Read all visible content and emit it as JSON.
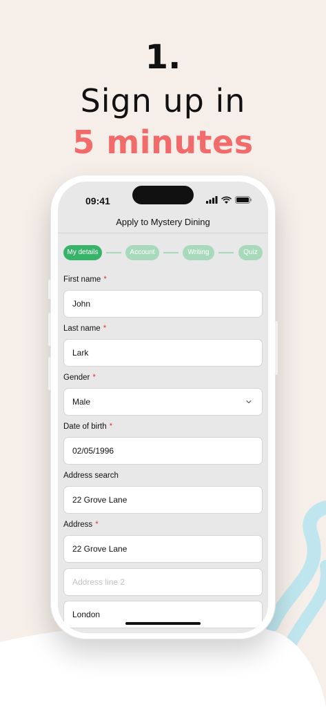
{
  "headline": {
    "step_number": "1.",
    "line1": "Sign up in",
    "line2": "5 minutes"
  },
  "colors": {
    "background": "#f5eee9",
    "accent_red": "#f26b6b",
    "wave_teal": "#bfe6ee",
    "step_active": "#37b36a",
    "step_inactive": "#a9d9bb",
    "required_star": "#e03a3a"
  },
  "status_bar": {
    "time": "09:41",
    "icons": [
      "cellular-signal-icon",
      "wifi-icon",
      "battery-icon"
    ]
  },
  "app": {
    "title": "Apply to Mystery Dining"
  },
  "stepper": {
    "steps": [
      {
        "label": "My details",
        "active": true
      },
      {
        "label": "Account",
        "active": false
      },
      {
        "label": "Writing",
        "active": false
      },
      {
        "label": "Quiz",
        "active": false
      }
    ]
  },
  "form": {
    "required_marker": "*",
    "first_name": {
      "label": "First name",
      "value": "John"
    },
    "last_name": {
      "label": "Last name",
      "value": "Lark"
    },
    "gender": {
      "label": "Gender",
      "value": "Male"
    },
    "dob": {
      "label": "Date of birth",
      "value": "02/05/1996"
    },
    "address_search": {
      "label": "Address search",
      "value": "22 Grove Lane"
    },
    "address": {
      "label": "Address",
      "line1": "22 Grove Lane",
      "line2_placeholder": "Address line 2",
      "city": "London"
    }
  }
}
